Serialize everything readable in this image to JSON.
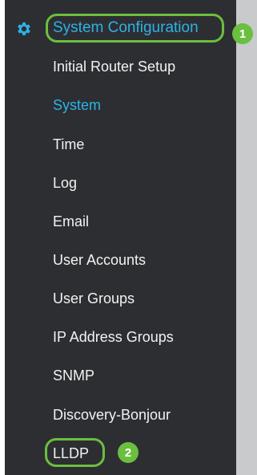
{
  "header": {
    "icon": "gear-icon",
    "label": "System Configuration",
    "callout": "1"
  },
  "menu": {
    "items": [
      {
        "label": "Initial Router Setup"
      },
      {
        "label": "System",
        "active": true
      },
      {
        "label": "Time"
      },
      {
        "label": "Log"
      },
      {
        "label": "Email"
      },
      {
        "label": "User Accounts"
      },
      {
        "label": "User Groups"
      },
      {
        "label": "IP Address Groups"
      },
      {
        "label": "SNMP"
      },
      {
        "label": "Discovery-Bonjour"
      },
      {
        "label": "LLDP",
        "callout": "2"
      }
    ]
  },
  "colors": {
    "sidebar_bg": "#2d2e32",
    "accent_blue": "#2bb3e6",
    "callout_green": "#6bbf3f",
    "text": "#f2f2f2"
  }
}
